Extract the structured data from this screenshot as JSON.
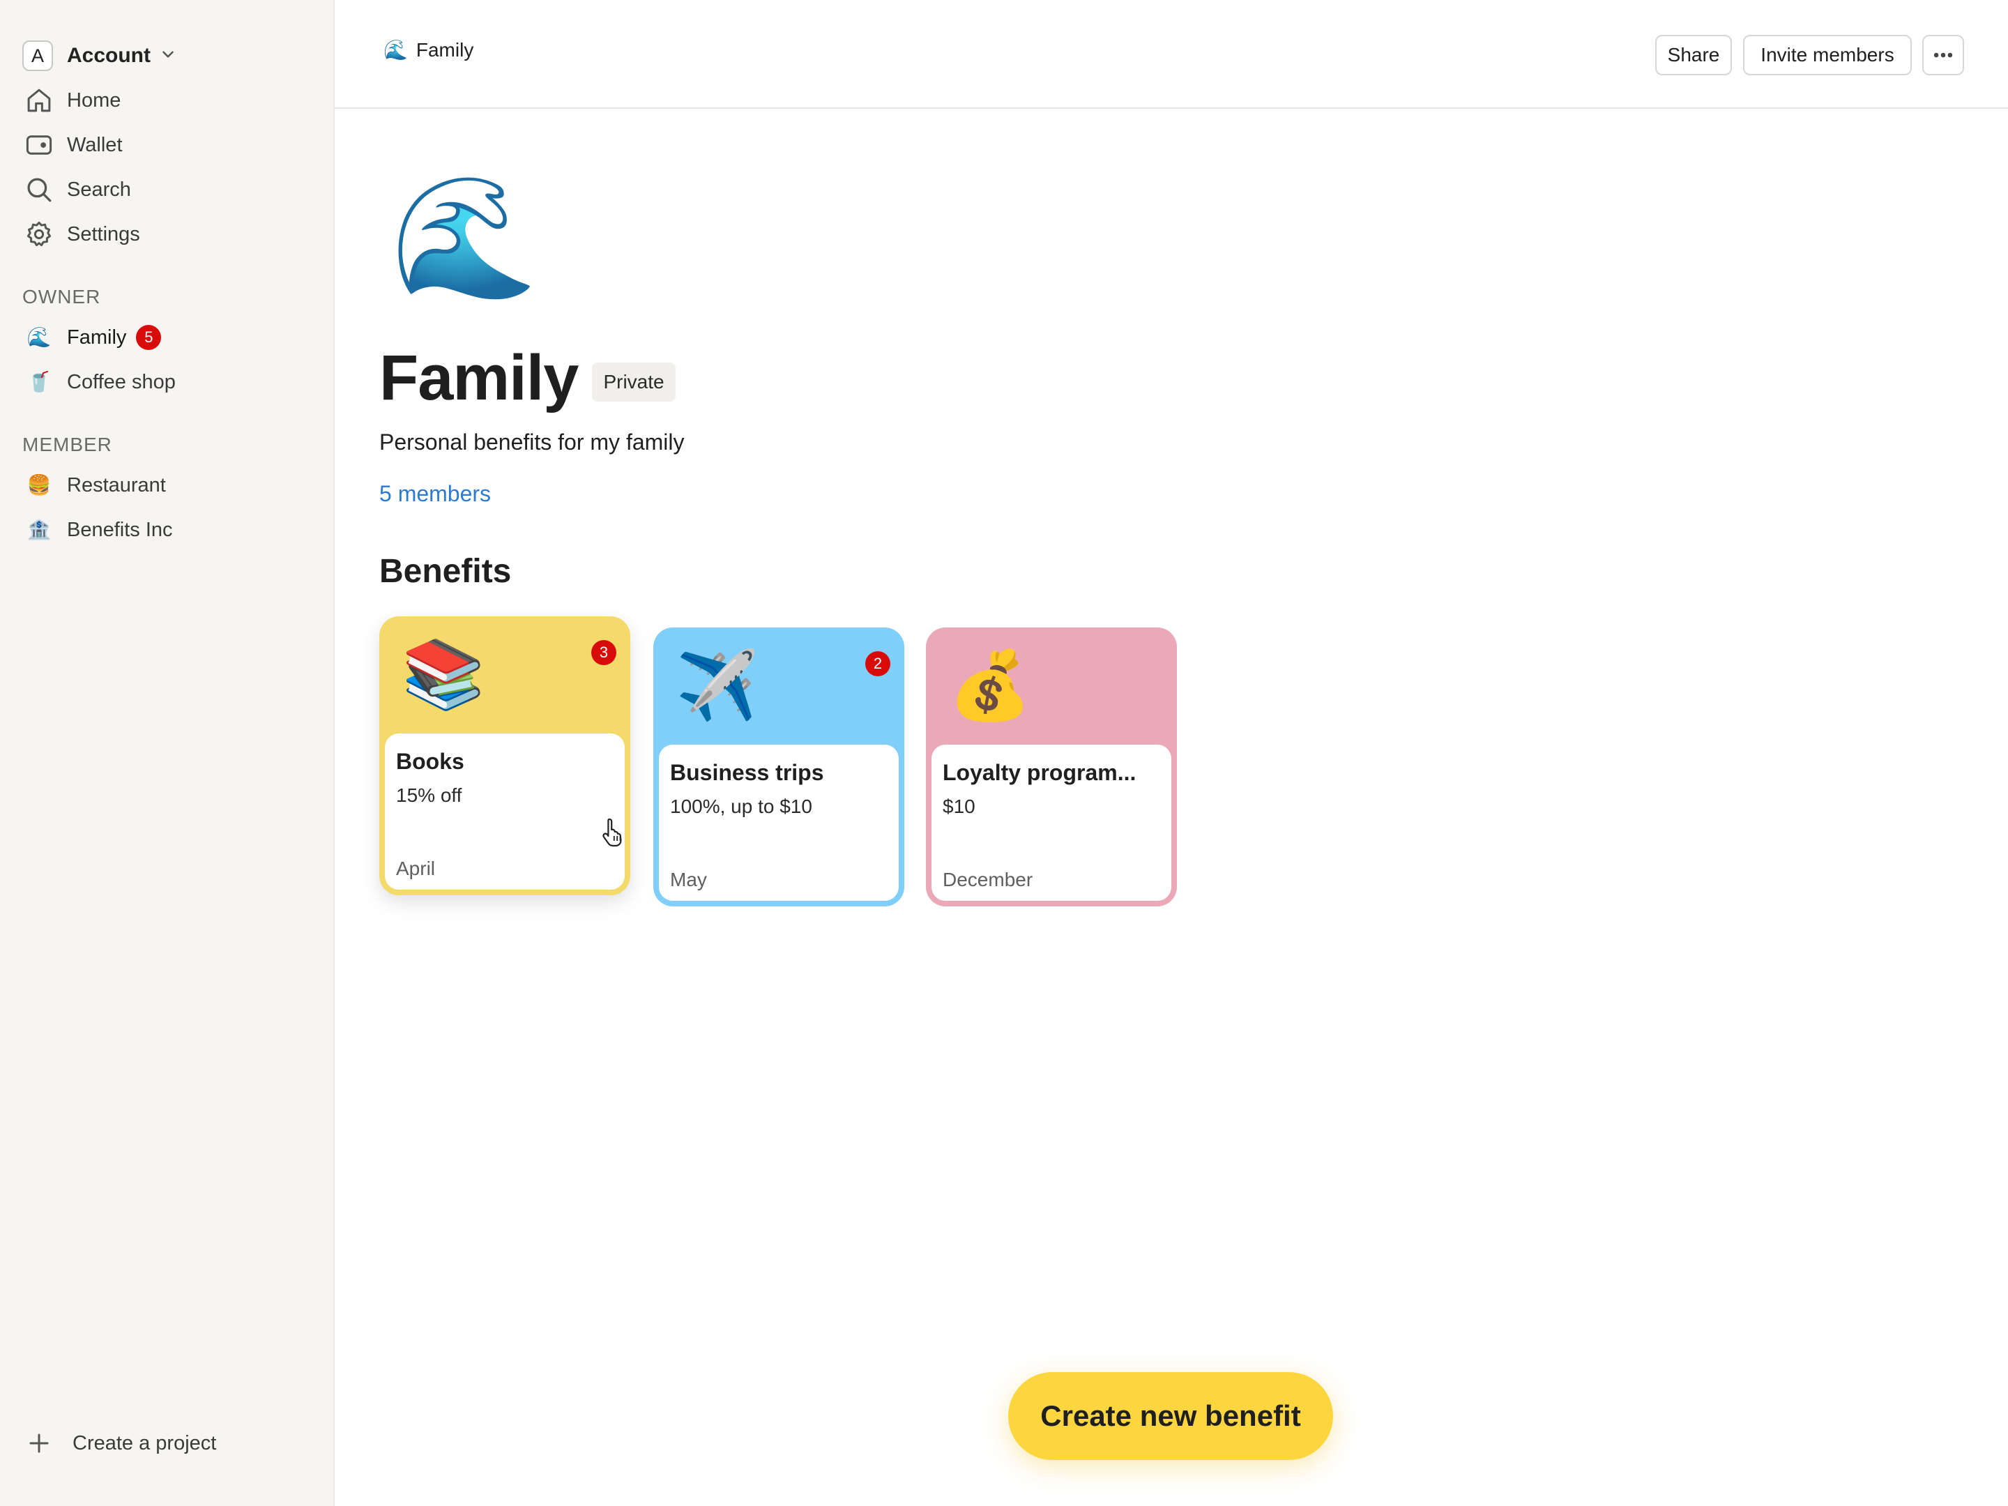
{
  "sidebar": {
    "account": {
      "initial": "A",
      "label": "Account"
    },
    "nav": [
      {
        "label": "Home",
        "icon": "home-icon"
      },
      {
        "label": "Wallet",
        "icon": "wallet-icon"
      },
      {
        "label": "Search",
        "icon": "search-icon"
      },
      {
        "label": "Settings",
        "icon": "gear-icon"
      }
    ],
    "owner_heading": "OWNER",
    "owner_projects": [
      {
        "label": "Family",
        "emoji": "🌊",
        "badge": "5"
      },
      {
        "label": "Coffee shop",
        "emoji": "🥤"
      }
    ],
    "member_heading": "MEMBER",
    "member_projects": [
      {
        "label": "Restaurant",
        "emoji": "🍔"
      },
      {
        "label": "Benefits Inc",
        "emoji": "🏦"
      }
    ],
    "create_project": "Create a project"
  },
  "topbar": {
    "crumb_emoji": "🌊",
    "crumb_label": "Family",
    "share": "Share",
    "invite": "Invite members"
  },
  "project": {
    "emoji": "🌊",
    "title": "Family",
    "visibility": "Private",
    "description": "Personal benefits for my family",
    "members_link": "5 members"
  },
  "benefits_heading": "Benefits",
  "benefits": [
    {
      "emoji": "📚",
      "title": "Books",
      "subtitle": "15% off",
      "month": "April",
      "badge": "3",
      "color": "#f4d96b"
    },
    {
      "emoji": "✈️",
      "title": "Business trips",
      "subtitle": "100%, up to $10",
      "month": "May",
      "badge": "2",
      "color": "#80cffb"
    },
    {
      "emoji": "💰",
      "title": "Loyalty program...",
      "subtitle": "$10",
      "month": "December",
      "color": "#eba9b8"
    }
  ],
  "cta_label": "Create new benefit"
}
